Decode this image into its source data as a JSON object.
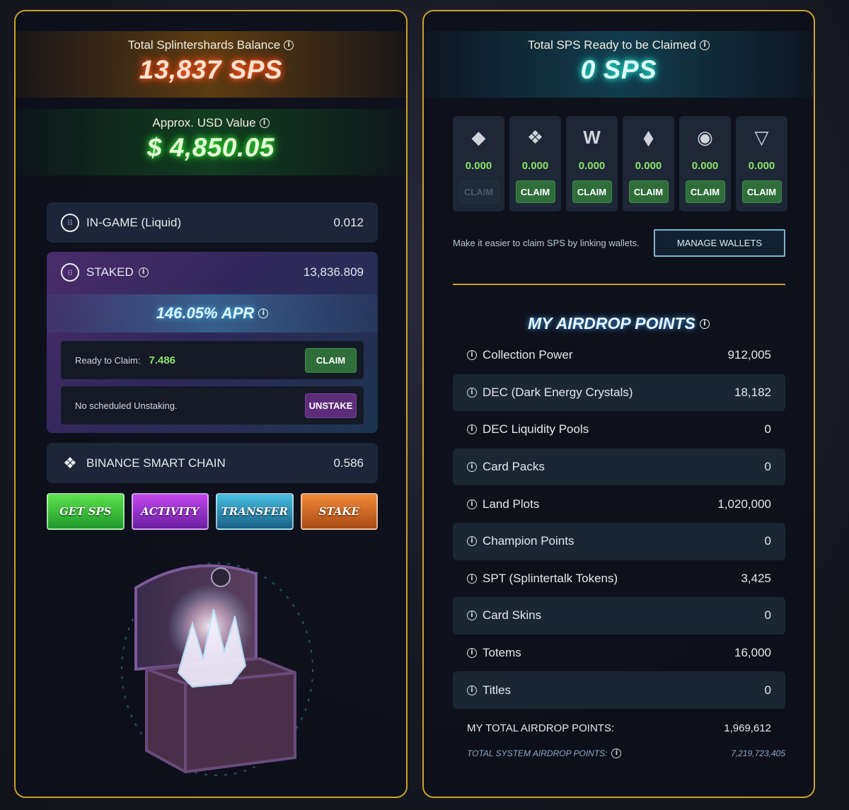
{
  "left": {
    "balance_label": "Total Splintershards Balance",
    "balance_value": "13,837 SPS",
    "usd_label": "Approx. USD Value",
    "usd_value": "$ 4,850.05",
    "ingame": {
      "label": "IN-GAME (Liquid)",
      "value": "0.012"
    },
    "staked": {
      "label": "STAKED",
      "value": "13,836.809",
      "apr": "146.05% APR",
      "ready_label": "Ready to Claim:",
      "ready_value": "7.486",
      "claim_button": "CLAIM",
      "unstake_text": "No scheduled Unstaking.",
      "unstake_button": "UNSTAKE"
    },
    "bsc": {
      "label": "BINANCE SMART CHAIN",
      "value": "0.586"
    },
    "actions": {
      "get_sps": "GET SPS",
      "activity": "ACTIVITY",
      "transfer": "TRANSFER",
      "stake": "STAKE"
    }
  },
  "right": {
    "claim_label": "Total SPS Ready to be Claimed",
    "claim_value": "0 SPS",
    "chains": [
      {
        "icon": "hive-icon",
        "glyph": "◆",
        "value": "0.000",
        "button": "CLAIM",
        "enabled": false
      },
      {
        "icon": "bnb-icon",
        "glyph": "❖",
        "value": "0.000",
        "button": "CLAIM",
        "enabled": true
      },
      {
        "icon": "wax-icon",
        "glyph": "W",
        "value": "0.000",
        "button": "CLAIM",
        "enabled": true
      },
      {
        "icon": "ethereum-icon",
        "glyph": "⬧",
        "value": "0.000",
        "button": "CLAIM",
        "enabled": true
      },
      {
        "icon": "steem-icon",
        "glyph": "◉",
        "value": "0.000",
        "button": "CLAIM",
        "enabled": true
      },
      {
        "icon": "tron-icon",
        "glyph": "▽",
        "value": "0.000",
        "button": "CLAIM",
        "enabled": true
      }
    ],
    "manage_text": "Make it easier to claim SPS by linking wallets.",
    "manage_button": "MANAGE WALLETS",
    "airdrop_title": "MY AIRDROP POINTS",
    "airdrop": [
      {
        "label": "Collection Power",
        "value": "912,005"
      },
      {
        "label": "DEC (Dark Energy Crystals)",
        "value": "18,182"
      },
      {
        "label": "DEC Liquidity Pools",
        "value": "0"
      },
      {
        "label": "Card Packs",
        "value": "0"
      },
      {
        "label": "Land Plots",
        "value": "1,020,000"
      },
      {
        "label": "Champion Points",
        "value": "0"
      },
      {
        "label": "SPT (Splintertalk Tokens)",
        "value": "3,425"
      },
      {
        "label": "Card Skins",
        "value": "0"
      },
      {
        "label": "Totems",
        "value": "16,000"
      },
      {
        "label": "Titles",
        "value": "0"
      }
    ],
    "total_label": "MY TOTAL AIRDROP POINTS:",
    "total_value": "1,969,612",
    "system_label": "TOTAL SYSTEM AIRDROP POINTS:",
    "system_value": "7,219,723,405"
  },
  "colors": {
    "frame": "#c9a227",
    "green_value": "#8ee26a",
    "claim_green": "#2f6e3a",
    "unstake_purple": "#5e2d7a"
  }
}
